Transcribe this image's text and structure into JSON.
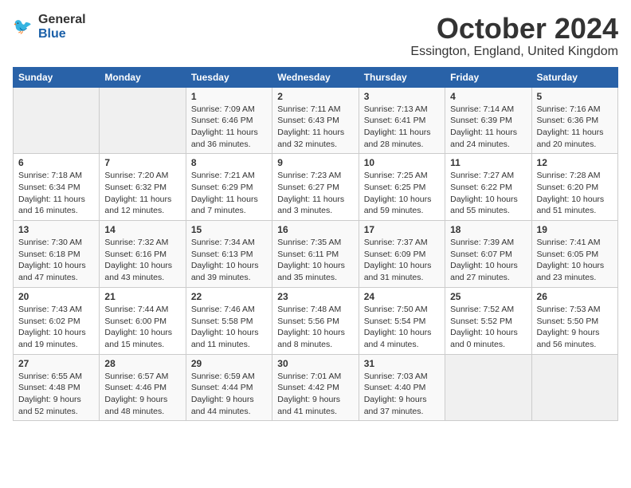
{
  "header": {
    "logo_general": "General",
    "logo_blue": "Blue",
    "month_title": "October 2024",
    "location": "Essington, England, United Kingdom"
  },
  "days_of_week": [
    "Sunday",
    "Monday",
    "Tuesday",
    "Wednesday",
    "Thursday",
    "Friday",
    "Saturday"
  ],
  "weeks": [
    [
      {
        "day": "",
        "info": ""
      },
      {
        "day": "",
        "info": ""
      },
      {
        "day": "1",
        "info": "Sunrise: 7:09 AM\nSunset: 6:46 PM\nDaylight: 11 hours and 36 minutes."
      },
      {
        "day": "2",
        "info": "Sunrise: 7:11 AM\nSunset: 6:43 PM\nDaylight: 11 hours and 32 minutes."
      },
      {
        "day": "3",
        "info": "Sunrise: 7:13 AM\nSunset: 6:41 PM\nDaylight: 11 hours and 28 minutes."
      },
      {
        "day": "4",
        "info": "Sunrise: 7:14 AM\nSunset: 6:39 PM\nDaylight: 11 hours and 24 minutes."
      },
      {
        "day": "5",
        "info": "Sunrise: 7:16 AM\nSunset: 6:36 PM\nDaylight: 11 hours and 20 minutes."
      }
    ],
    [
      {
        "day": "6",
        "info": "Sunrise: 7:18 AM\nSunset: 6:34 PM\nDaylight: 11 hours and 16 minutes."
      },
      {
        "day": "7",
        "info": "Sunrise: 7:20 AM\nSunset: 6:32 PM\nDaylight: 11 hours and 12 minutes."
      },
      {
        "day": "8",
        "info": "Sunrise: 7:21 AM\nSunset: 6:29 PM\nDaylight: 11 hours and 7 minutes."
      },
      {
        "day": "9",
        "info": "Sunrise: 7:23 AM\nSunset: 6:27 PM\nDaylight: 11 hours and 3 minutes."
      },
      {
        "day": "10",
        "info": "Sunrise: 7:25 AM\nSunset: 6:25 PM\nDaylight: 10 hours and 59 minutes."
      },
      {
        "day": "11",
        "info": "Sunrise: 7:27 AM\nSunset: 6:22 PM\nDaylight: 10 hours and 55 minutes."
      },
      {
        "day": "12",
        "info": "Sunrise: 7:28 AM\nSunset: 6:20 PM\nDaylight: 10 hours and 51 minutes."
      }
    ],
    [
      {
        "day": "13",
        "info": "Sunrise: 7:30 AM\nSunset: 6:18 PM\nDaylight: 10 hours and 47 minutes."
      },
      {
        "day": "14",
        "info": "Sunrise: 7:32 AM\nSunset: 6:16 PM\nDaylight: 10 hours and 43 minutes."
      },
      {
        "day": "15",
        "info": "Sunrise: 7:34 AM\nSunset: 6:13 PM\nDaylight: 10 hours and 39 minutes."
      },
      {
        "day": "16",
        "info": "Sunrise: 7:35 AM\nSunset: 6:11 PM\nDaylight: 10 hours and 35 minutes."
      },
      {
        "day": "17",
        "info": "Sunrise: 7:37 AM\nSunset: 6:09 PM\nDaylight: 10 hours and 31 minutes."
      },
      {
        "day": "18",
        "info": "Sunrise: 7:39 AM\nSunset: 6:07 PM\nDaylight: 10 hours and 27 minutes."
      },
      {
        "day": "19",
        "info": "Sunrise: 7:41 AM\nSunset: 6:05 PM\nDaylight: 10 hours and 23 minutes."
      }
    ],
    [
      {
        "day": "20",
        "info": "Sunrise: 7:43 AM\nSunset: 6:02 PM\nDaylight: 10 hours and 19 minutes."
      },
      {
        "day": "21",
        "info": "Sunrise: 7:44 AM\nSunset: 6:00 PM\nDaylight: 10 hours and 15 minutes."
      },
      {
        "day": "22",
        "info": "Sunrise: 7:46 AM\nSunset: 5:58 PM\nDaylight: 10 hours and 11 minutes."
      },
      {
        "day": "23",
        "info": "Sunrise: 7:48 AM\nSunset: 5:56 PM\nDaylight: 10 hours and 8 minutes."
      },
      {
        "day": "24",
        "info": "Sunrise: 7:50 AM\nSunset: 5:54 PM\nDaylight: 10 hours and 4 minutes."
      },
      {
        "day": "25",
        "info": "Sunrise: 7:52 AM\nSunset: 5:52 PM\nDaylight: 10 hours and 0 minutes."
      },
      {
        "day": "26",
        "info": "Sunrise: 7:53 AM\nSunset: 5:50 PM\nDaylight: 9 hours and 56 minutes."
      }
    ],
    [
      {
        "day": "27",
        "info": "Sunrise: 6:55 AM\nSunset: 4:48 PM\nDaylight: 9 hours and 52 minutes."
      },
      {
        "day": "28",
        "info": "Sunrise: 6:57 AM\nSunset: 4:46 PM\nDaylight: 9 hours and 48 minutes."
      },
      {
        "day": "29",
        "info": "Sunrise: 6:59 AM\nSunset: 4:44 PM\nDaylight: 9 hours and 44 minutes."
      },
      {
        "day": "30",
        "info": "Sunrise: 7:01 AM\nSunset: 4:42 PM\nDaylight: 9 hours and 41 minutes."
      },
      {
        "day": "31",
        "info": "Sunrise: 7:03 AM\nSunset: 4:40 PM\nDaylight: 9 hours and 37 minutes."
      },
      {
        "day": "",
        "info": ""
      },
      {
        "day": "",
        "info": ""
      }
    ]
  ]
}
